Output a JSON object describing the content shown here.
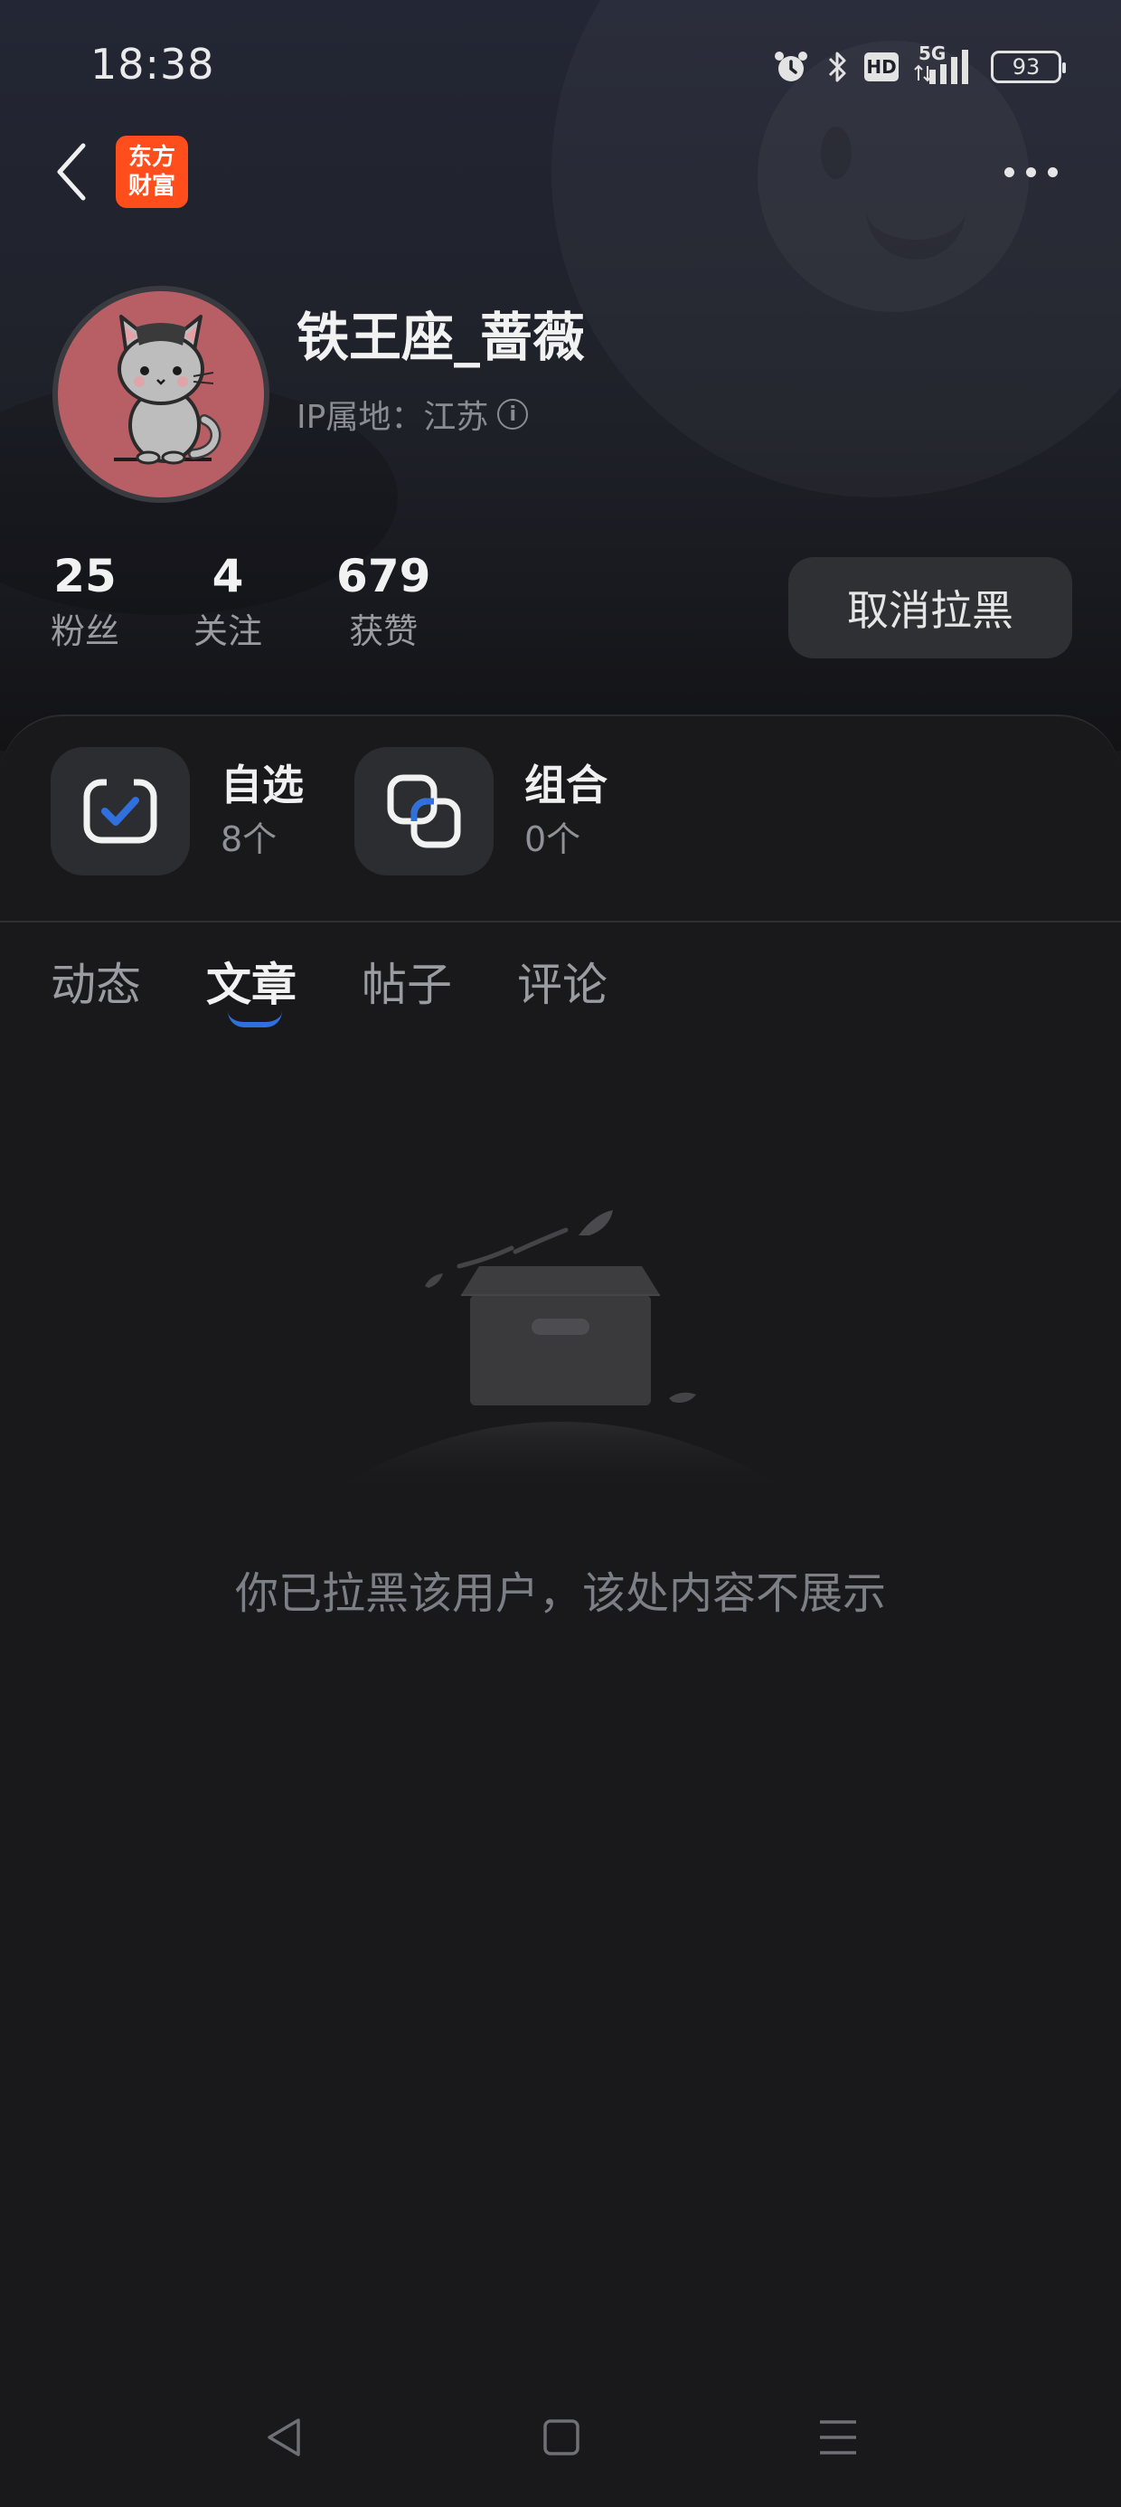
{
  "status_bar": {
    "time": "18:38",
    "hd_label": "HD",
    "network_label": "5G",
    "battery": "93",
    "icons": [
      "alarm-icon",
      "bluetooth-icon",
      "hd-icon",
      "signal-icon",
      "battery-icon"
    ]
  },
  "top_bar": {
    "logo_line1": "东方",
    "logo_line2": "财富",
    "back_icon": "chevron-left-icon",
    "more_icon": "more-horizontal-icon",
    "logo_color": "#ff4d1c"
  },
  "profile": {
    "username": "铁王座_蔷薇",
    "ip_location": "IP属地：江苏",
    "avatar_bg": "#b75f65",
    "stats": [
      {
        "value": "25",
        "label": "粉丝"
      },
      {
        "value": "4",
        "label": "关注"
      },
      {
        "value": "679",
        "label": "获赞"
      }
    ],
    "unblock_button": "取消拉黑"
  },
  "shortcuts": [
    {
      "title": "自选",
      "count": "8个",
      "icon": "watchlist-check-icon"
    },
    {
      "title": "组合",
      "count": "0个",
      "icon": "portfolio-overlap-icon"
    }
  ],
  "tabs": [
    {
      "label": "动态",
      "active": false
    },
    {
      "label": "文章",
      "active": true
    },
    {
      "label": "帖子",
      "active": false
    },
    {
      "label": "评论",
      "active": false
    }
  ],
  "accent_color": "#2f6fde",
  "empty_state": {
    "message": "你已拉黑该用户，该处内容不展示",
    "icon": "empty-box-illustration"
  },
  "nav_bar": {
    "icons": [
      "back-triangle-icon",
      "home-square-icon",
      "menu-lines-icon"
    ]
  }
}
